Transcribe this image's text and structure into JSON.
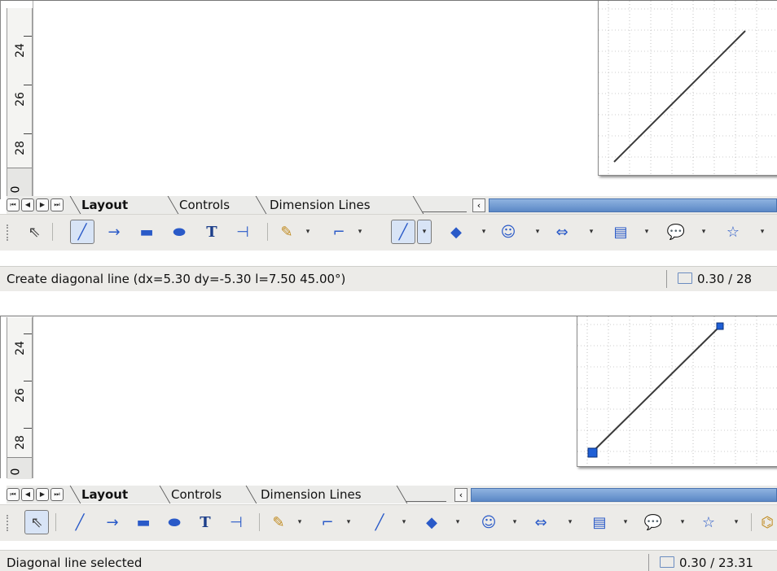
{
  "panels": [
    {
      "ruler": {
        "labels": [
          "24",
          "26",
          "28"
        ],
        "zero": "0"
      },
      "tabs": {
        "active": "Layout",
        "others": [
          "Controls",
          "Dimension Lines"
        ]
      },
      "toolbar": {
        "line_button_pressed": true,
        "select_button_pressed": false,
        "line_variant_pressed": true,
        "icons": [
          "select-arrow-icon",
          "line-icon",
          "line-arrow-icon",
          "rectangle-icon",
          "ellipse-icon",
          "text-icon",
          "dimension-line-icon",
          "curve-icon",
          "connector-icon",
          "lines-arrows-icon",
          "basic-shapes-icon",
          "symbol-shapes-icon",
          "block-arrows-icon",
          "flowchart-icon",
          "callouts-icon",
          "stars-icon"
        ]
      },
      "status": {
        "message": "Create diagonal line (dx=5.30 dy=-5.30  l=7.50 45.00°)",
        "position": "0.30 / 28"
      },
      "line_selected": false
    },
    {
      "ruler": {
        "labels": [
          "24",
          "26",
          "28"
        ],
        "zero": "0"
      },
      "tabs": {
        "active": "Layout",
        "others": [
          "Controls",
          "Dimension Lines"
        ]
      },
      "toolbar": {
        "line_button_pressed": false,
        "select_button_pressed": true,
        "line_variant_pressed": false,
        "icons": [
          "select-arrow-icon",
          "line-icon",
          "line-arrow-icon",
          "rectangle-icon",
          "ellipse-icon",
          "text-icon",
          "dimension-line-icon",
          "curve-icon",
          "connector-icon",
          "lines-arrows-icon",
          "basic-shapes-icon",
          "symbol-shapes-icon",
          "block-arrows-icon",
          "flowchart-icon",
          "callouts-icon",
          "stars-icon",
          "points-icon"
        ]
      },
      "status": {
        "message": "Diagonal line selected",
        "position": "0.30 / 23.31"
      },
      "line_selected": true
    }
  ],
  "colors": {
    "accent": "#2a5ac8",
    "handle": "#1f5fd6",
    "scrollbar": "#5b88c6",
    "grid": "#9a9a9a"
  }
}
